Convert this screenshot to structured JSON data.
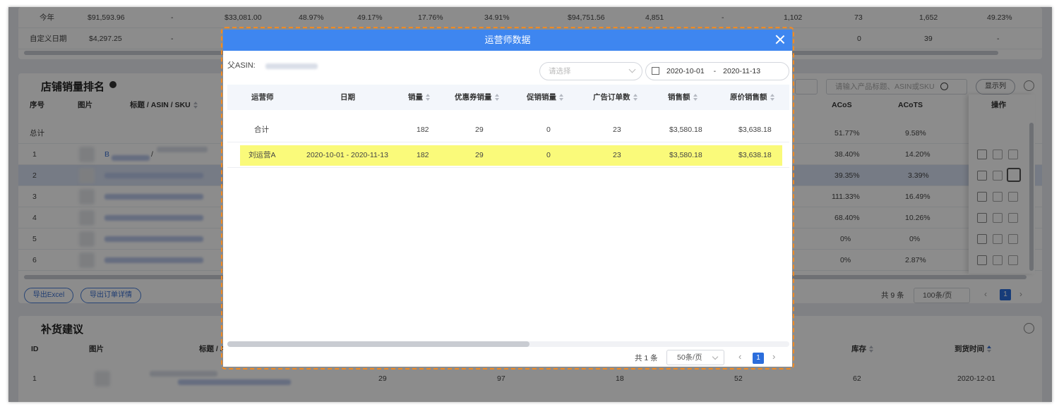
{
  "background": {
    "summary_rows": [
      {
        "label": "今年",
        "cells": [
          "$91,593.96",
          "-",
          "$33,081.00",
          "48.97%",
          "49.17%",
          "17.76%",
          "34.91%",
          "$94,751.56",
          "4,851",
          "-",
          "1,102",
          "73",
          "1,652",
          "49.23%"
        ]
      },
      {
        "label": "自定义日期",
        "cells": [
          "$4,297.25",
          "-",
          "",
          "",
          "",
          "",
          "",
          "",
          "",
          "",
          "",
          "0",
          "39",
          "-"
        ]
      }
    ],
    "rank_section": {
      "title": "店铺销量排名",
      "search_placeholder": "请输入产品标题、ASIN或SKU",
      "display_columns_label": "显示列",
      "columns": {
        "index": "序号",
        "image": "图片",
        "title": "标题 / ASIN / SKU",
        "acos": "ACoS",
        "acots": "ACoTS",
        "ops": "操作"
      },
      "total_label": "总计",
      "total_acos": "51.77%",
      "total_acots": "9.58%",
      "rows": [
        {
          "index": "1",
          "acos": "38.40%",
          "acots": "14.20%",
          "asin_prefix": "B",
          "sep": "/"
        },
        {
          "index": "2",
          "acos": "39.35%",
          "acots": "3.39%",
          "asin_prefix": "",
          "sep": ""
        },
        {
          "index": "3",
          "acos": "111.33%",
          "acots": "16.49%",
          "asin_prefix": "",
          "sep": ""
        },
        {
          "index": "4",
          "acos": "68.40%",
          "acots": "10.26%",
          "asin_prefix": "",
          "sep": ""
        },
        {
          "index": "5",
          "acos": "0%",
          "acots": "0%",
          "asin_prefix": "",
          "sep": ""
        },
        {
          "index": "6",
          "acos": "0%",
          "acots": "2.87%",
          "asin_prefix": "",
          "sep": ""
        }
      ],
      "export_excel": "导出Excel",
      "export_orders": "导出订单详情",
      "total_count": "共 9 条",
      "page_size": "100条/页",
      "current_page": "1"
    },
    "restock_section": {
      "title": "补货建议",
      "columns": {
        "id": "ID",
        "image": "图片",
        "title": "标题 / A",
        "stock": "库存",
        "arrival": "到货时间"
      },
      "row": {
        "id": "1",
        "v1": "29",
        "v2": "97",
        "v3": "18",
        "v4": "52",
        "stock": "62",
        "arrival": "2020-12-01"
      }
    }
  },
  "modal": {
    "title": "运营师数据",
    "parent_asin_label": "父ASIN:",
    "select_placeholder": "请选择",
    "date_start": "2020-10-01",
    "date_sep": "-",
    "date_end": "2020-11-13",
    "columns": [
      "运营师",
      "日期",
      "销量",
      "优惠券销量",
      "促销销量",
      "广告订单数",
      "销售额",
      "原价销售额"
    ],
    "total_row": {
      "label": "合计",
      "date": "",
      "sales": "182",
      "coupon": "29",
      "promo": "0",
      "ad_orders": "23",
      "revenue": "$3,580.18",
      "orig_revenue": "$3,638.18"
    },
    "rows": [
      {
        "operator": "刘运营A",
        "date": "2020-10-01 - 2020-11-13",
        "sales": "182",
        "coupon": "29",
        "promo": "0",
        "ad_orders": "23",
        "revenue": "$3,580.18",
        "orig_revenue": "$3,638.18"
      }
    ],
    "total_count": "共 1 条",
    "page_size": "50条/页",
    "current_page": "1"
  },
  "colors": {
    "accent": "#3e86f0",
    "highlight": "#fafa7a",
    "annotation": "#f08a24"
  }
}
